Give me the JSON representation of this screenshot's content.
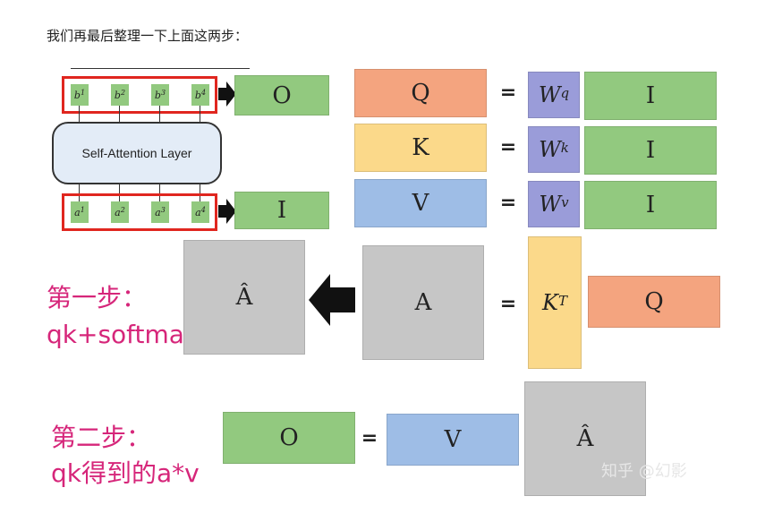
{
  "heading": "我们再最后整理一下上面这两步：",
  "diagram": {
    "attention_layer_label": "Self-Attention Layer",
    "output_tokens": [
      "b",
      "b",
      "b",
      "b"
    ],
    "output_token_indices": [
      "1",
      "2",
      "3",
      "4"
    ],
    "input_tokens": [
      "a",
      "a",
      "a",
      "a"
    ],
    "input_token_indices": [
      "1",
      "2",
      "3",
      "4"
    ],
    "output_box": "O",
    "input_box": "I"
  },
  "equations": {
    "q_row": {
      "lhs": "Q",
      "eq": "=",
      "w": "W",
      "w_sup": "q",
      "rhs": "I"
    },
    "k_row": {
      "lhs": "K",
      "eq": "=",
      "w": "W",
      "w_sup": "k",
      "rhs": "I"
    },
    "v_row": {
      "lhs": "V",
      "eq": "=",
      "w": "W",
      "w_sup": "v",
      "rhs": "I"
    }
  },
  "step1": {
    "title": "第一步：",
    "subtitle": "qk+softmax",
    "a_hat": "Â",
    "a": "A",
    "eq": "=",
    "kt": "K",
    "kt_sup": "T",
    "q": "Q"
  },
  "step2": {
    "title": "第二步：",
    "subtitle": "qk得到的a*v",
    "o": "O",
    "eq": "=",
    "v": "V",
    "a_hat": "Â"
  },
  "watermark": "知乎 @幻影",
  "colors": {
    "green": "#92c97f",
    "orange": "#f4a47f",
    "yellow": "#fbd98a",
    "blue": "#9ebde6",
    "purple": "#9a9cd9",
    "gray": "#c6c6c6",
    "step_pink": "#d6267a",
    "frame_red": "#e0261f"
  }
}
